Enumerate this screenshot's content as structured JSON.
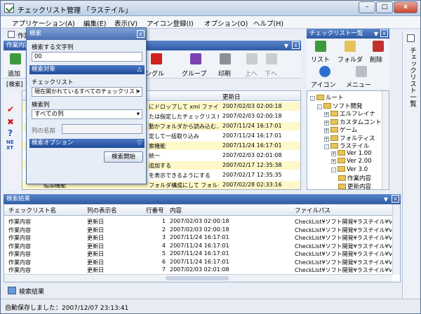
{
  "window": {
    "title": "チェックリスト管理 「ラステイル」",
    "min": "–",
    "max": "□",
    "close": "x"
  },
  "menu": [
    "アプリケーション(A)",
    "編集(E)",
    "表示(V)",
    "アイコン登録(I)",
    "オプション(O)",
    "ヘルプ(H)"
  ],
  "left_panel": {
    "title": "作業内容",
    "doc_tab": "作業"
  },
  "toolbar": {
    "add": "追加",
    "toggle": "ングル",
    "group": "グループ",
    "print": "印刷",
    "up": "上へ",
    "down": "下へ",
    "filter_label": "[検索]"
  },
  "list_header": {
    "date": "更新日"
  },
  "list_rows": [
    {
      "text": "にドロップして xml ファイ...",
      "date": "2007/02/03 02:00:18",
      "hl": true
    },
    {
      "text": "たは指定したチェックリスト...",
      "date": "2007/02/03 02:00:18",
      "hl": false
    },
    {
      "text": "動かフォルダから読み込む...",
      "date": "2007/11/24 16:17:01",
      "hl": true
    },
    {
      "text": "定して一括取り込み",
      "date": "2007/11/24 16:17:01",
      "hl": false
    },
    {
      "text": "索機能",
      "date": "2007/11/24 16:17:01",
      "hl": true
    },
    {
      "text": "統一",
      "date": "2007/02/03 02:01:08",
      "hl": false
    },
    {
      "text": "追加する",
      "date": "2007/02/17 12:35:38",
      "hl": true
    },
    {
      "text": "を表示できるようにする",
      "date": "2007/02/17 12:35:35",
      "hl": false
    },
    {
      "text": "フォルダ構成にして フォルダあれば自動的にリー...",
      "date": "2007/02/28 02:33:16",
      "hl": true
    }
  ],
  "list_row_prefix": "追加機能",
  "right_panel": {
    "title": "チェックリスト一覧",
    "list_btn": "リスト",
    "folder_btn": "フォルダ",
    "delete_btn": "削除",
    "icon_btn": "アイコン",
    "menu_btn": "メニュー"
  },
  "tree": [
    {
      "label": "ルート",
      "level": 0,
      "pm": "-"
    },
    {
      "label": "ソフト開発",
      "level": 1,
      "pm": "-"
    },
    {
      "label": "エルフレイナ",
      "level": 2,
      "pm": "+"
    },
    {
      "label": "カスタムコントロール",
      "level": 2,
      "pm": "+"
    },
    {
      "label": "ゲーム",
      "level": 2,
      "pm": "+"
    },
    {
      "label": "フォルティス",
      "level": 2,
      "pm": "+"
    },
    {
      "label": "ラステイル",
      "level": 2,
      "pm": "-"
    },
    {
      "label": "Ver 1.00",
      "level": 3,
      "pm": "+"
    },
    {
      "label": "Ver 2.00",
      "level": 3,
      "pm": "+"
    },
    {
      "label": "Ver 3.0",
      "level": 3,
      "pm": "-"
    },
    {
      "label": "作業内容",
      "level": 4,
      "pm": ""
    },
    {
      "label": "更新内容",
      "level": 4,
      "pm": ""
    }
  ],
  "vertical_tab": "チェックリスト一覧",
  "search_dialog": {
    "title": "検索",
    "close": "x",
    "query_label": "検索する文字列",
    "query_value": "00",
    "target_section": "検索対象",
    "checklist_label": "チェックリスト",
    "checklist_value": "現在開かれているすべてのチェックリスト",
    "column_label": "検索列",
    "column_value": "すべての列",
    "column_name_label": "列の名前",
    "options_section": "検索オプション",
    "start_button": "検索開始"
  },
  "results": {
    "title": "検索結果",
    "columns": [
      "チェックリスト名",
      "列の表示名",
      "行番号",
      "内容",
      "ファイルパス"
    ],
    "rows": [
      [
        "作業内容",
        "更新日",
        "1",
        "2007/02/03 02:00:18",
        "CheckList¥ソフト開発¥ラステイル¥Ver"
      ],
      [
        "作業内容",
        "更新日",
        "2",
        "2007/02/03 02:00:18",
        "CheckList¥ソフト開発¥ラステイル¥Ver"
      ],
      [
        "作業内容",
        "更新日",
        "3",
        "2007/11/24 16:17:01",
        "CheckList¥ソフト開発¥ラステイル¥Ver"
      ],
      [
        "作業内容",
        "更新日",
        "4",
        "2007/11/24 16:17:01",
        "CheckList¥ソフト開発¥ラステイル¥Ver"
      ],
      [
        "作業内容",
        "更新日",
        "5",
        "2007/11/24 16:17:01",
        "CheckList¥ソフト開発¥ラステイル¥Ver"
      ],
      [
        "作業内容",
        "更新日",
        "6",
        "2007/11/24 16:17:01",
        "CheckList¥ソフト開発¥ラステイル¥Ver"
      ],
      [
        "作業内容",
        "更新日",
        "7",
        "2007/02/03 02:01:08",
        "CheckList¥ソフト開発¥ラステイル¥Ver"
      ]
    ],
    "bottom_tab": "検索結果"
  },
  "status": "自動保存しました：2007/12/07 23:13:41",
  "colors": {
    "accent": "#2e5aa6",
    "highlight": "#fff8c8",
    "check": "#d01818"
  }
}
